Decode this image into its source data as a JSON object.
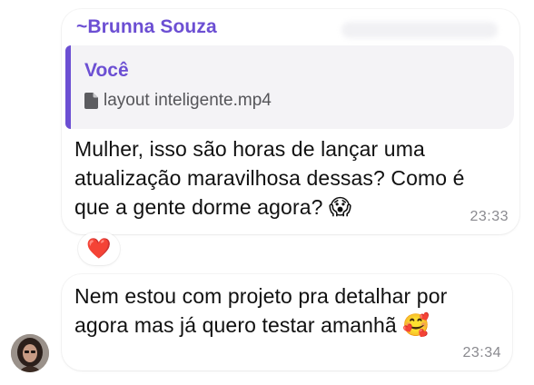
{
  "colors": {
    "sender_name": "#6c4fd3",
    "quote_author": "#6c4fd3",
    "quote_bar": "#6c4fd3",
    "reaction_heart": "#e0202e"
  },
  "messages": [
    {
      "sender": "~Brunna Souza",
      "reply": {
        "author": "Você",
        "file_icon": "document-icon",
        "file_name": "layout inteligente.mp4"
      },
      "text_line1": "Mulher, isso são horas de lançar uma",
      "text_line2": "atualização maravilhosa dessas? Como é",
      "text_line3": "que a gente dorme agora? ",
      "emoji": "😱",
      "time": "23:33",
      "reaction": "❤️"
    },
    {
      "text_line1": "Nem estou com projeto pra detalhar por",
      "text_line2": "agora mas já quero testar amanhã ",
      "emoji": "🥰",
      "time": "23:34"
    }
  ]
}
